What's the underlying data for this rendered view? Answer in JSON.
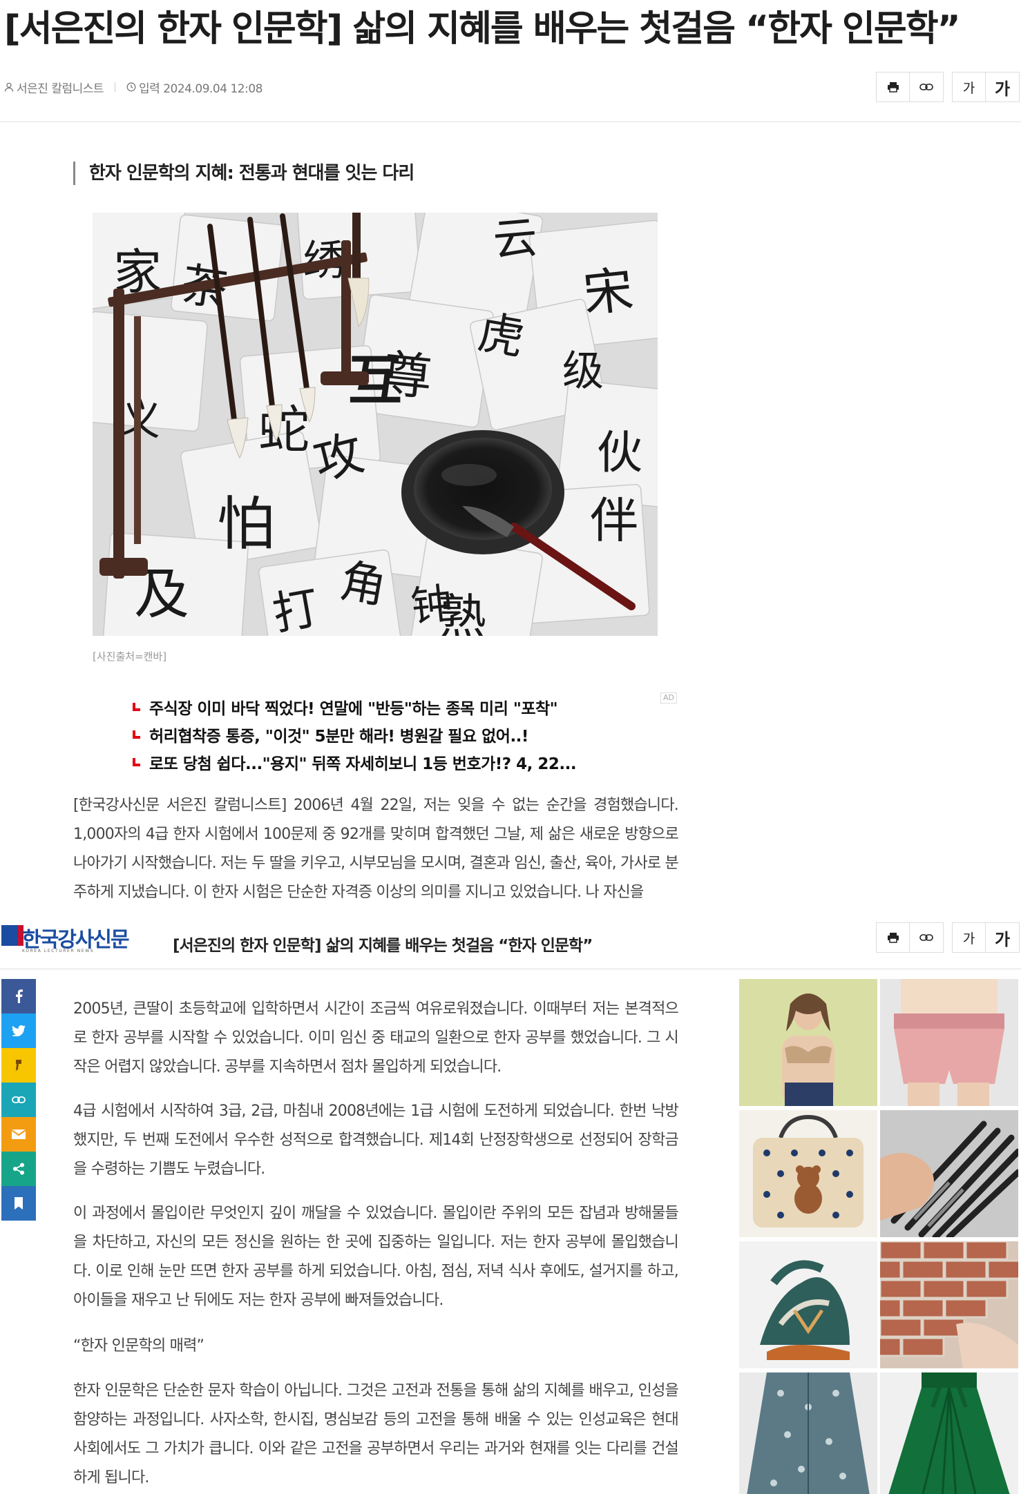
{
  "article": {
    "title": "[서은진의 한자 인문학] 삶의 지혜를 배우는 첫걸음 “한자 인문학”",
    "author": "서은진 칼럼니스트",
    "date_label": "입력 2024.09.04 12:08",
    "subhead": "한자 인문학의 지혜: 전통과 현대를 잇는 다리",
    "caption": "[사진출처=캔바]",
    "paragraphs": [
      "[한국강사신문 서은진 칼럼니스트] 2006년 4월 22일, 저는 잊을 수 없는 순간을 경험했습니다. 1,000자의 4급 한자 시험에서 100문제 중 92개를 맞히며 합격했던 그날, 제 삶은 새로운 방향으로 나아가기 시작했습니다. 저는 두 딸을 키우고, 시부모님을 모시며, 결혼과 임신, 출산, 육아, 가사로 분주하게 지냈습니다. 이 한자 시험은 단순한 자격증 이상의 의미를 지니고 있었습니다. 나 자신을",
      "2005년, 큰딸이 초등학교에 입학하면서 시간이 조금씩 여유로워졌습니다. 이때부터 저는 본격적으로 한자 공부를 시작할 수 있었습니다. 이미 임신 중 태교의 일환으로 한자 공부를 했었습니다. 그 시작은 어렵지 않았습니다. 공부를 지속하면서 점차 몰입하게 되었습니다.",
      "4급 시험에서 시작하여 3급, 2급, 마침내 2008년에는 1급 시험에 도전하게 되었습니다. 한번 낙방했지만, 두 번째 도전에서 우수한 성적으로 합격했습니다. 제14회 난정장학생으로 선정되어 장학금을 수령하는 기쁨도 누렸습니다.",
      "이 과정에서 몰입이란 무엇인지 깊이 깨달을 수 있었습니다. 몰입이란 주위의 모든 잡념과 방해물들을 차단하고, 자신의 모든 정신을 원하는 한 곳에 집중하는 일입니다. 저는 한자 공부에 몰입했습니다. 이로 인해 눈만 뜨면 한자 공부를 하게 되었습니다. 아침, 점심, 저녁 식사 후에도, 설거지를 하고, 아이들을 재우고 난 뒤에도 저는 한자 공부에 빠져들었습니다.",
      "“한자 인문학의 매력”",
      "한자 인문학은 단순한 문자 학습이 아닙니다. 그것은 고전과 전통을 통해 삶의 지혜를 배우고, 인성을 함양하는 과정입니다. 사자소학, 한시집, 명심보감 등의 고전을 통해 배울 수 있는 인성교육은 현대 사회에서도 그 가치가 큽니다. 이와 같은 고전을 공부하면서 우리는 과거와 현재를 잇는 다리를 건설하게 됩니다."
    ]
  },
  "toolbar": {
    "font_small_label": "가",
    "font_large_label": "가",
    "print_icon": "print-icon",
    "link_icon": "link-icon"
  },
  "ad_links": {
    "tag": "AD",
    "items": [
      "주식장 이미 바닥 찍었다! 연말에 \"반등\"하는 종목 미리 \"포착\"",
      "허리협착증 통증, \"이것\" 5분만 해라! 병원갈 필요 없어..!",
      "로또 당첨 쉽다...\"용지\" 뒤쪽 자세히보니 1등 번호가!? 4, 22..."
    ]
  },
  "sticky_header": {
    "logo_name": "한국강사신문",
    "logo_sub": "KOREA LECTURER NEWS",
    "title": "[서은진의 한자 인문학] 삶의 지혜를 배우는 첫걸음 “한자 인문학”"
  },
  "share_buttons": [
    {
      "name": "facebook",
      "color": "#3b5998"
    },
    {
      "name": "twitter",
      "color": "#1da1f2"
    },
    {
      "name": "kakaostory",
      "color": "#f7c600"
    },
    {
      "name": "copy-link",
      "color": "#1aa6b7"
    },
    {
      "name": "email",
      "color": "#f39c12"
    },
    {
      "name": "share",
      "color": "#17a589"
    },
    {
      "name": "bookmark",
      "color": "#2c6fbb"
    }
  ],
  "colors": {
    "brand_blue": "#1a4ca1",
    "ad_bullet_red": "#e60012"
  }
}
